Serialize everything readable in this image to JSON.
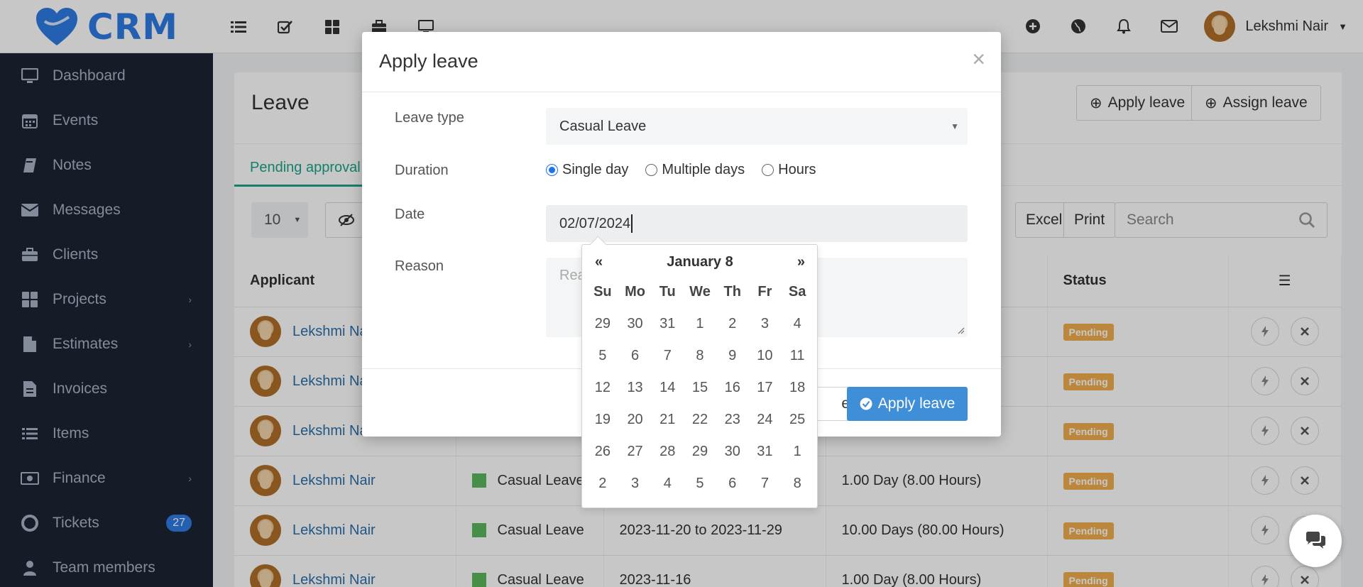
{
  "brand": {
    "name": "CRM",
    "logo_color": "#2d7be5"
  },
  "topbar": {
    "left_icons": [
      "list-icon",
      "check-square-icon",
      "grid-icon",
      "briefcase-icon",
      "monitor-icon"
    ],
    "right_icons": [
      "plus-circle-icon",
      "globe-icon",
      "bell-icon",
      "mail-icon"
    ],
    "user_name": "Lekshmi Nair"
  },
  "sidebar": {
    "items": [
      {
        "label": "Dashboard",
        "icon": "monitor-icon"
      },
      {
        "label": "Events",
        "icon": "calendar-icon"
      },
      {
        "label": "Notes",
        "icon": "book-icon"
      },
      {
        "label": "Messages",
        "icon": "envelope-icon"
      },
      {
        "label": "Clients",
        "icon": "briefcase-icon"
      },
      {
        "label": "Projects",
        "icon": "grid-icon",
        "has_submenu": true
      },
      {
        "label": "Estimates",
        "icon": "file-icon",
        "has_submenu": true
      },
      {
        "label": "Invoices",
        "icon": "file-text-icon"
      },
      {
        "label": "Items",
        "icon": "list-icon"
      },
      {
        "label": "Finance",
        "icon": "money-icon",
        "has_submenu": true
      },
      {
        "label": "Tickets",
        "icon": "lifebuoy-icon",
        "badge": "27"
      },
      {
        "label": "Team members",
        "icon": "user-icon"
      }
    ]
  },
  "page": {
    "title": "Leave",
    "apply_leave_label": "Apply leave",
    "assign_leave_label": "Assign leave",
    "active_tab": "Pending approval",
    "page_size": "10",
    "excel_label": "Excel",
    "print_label": "Print",
    "search_placeholder": "Search",
    "table": {
      "headers": [
        "Applicant",
        "",
        "",
        "",
        "Status",
        ""
      ],
      "rows": [
        {
          "applicant": "Lekshmi Nair",
          "type": "",
          "date": "",
          "duration": "",
          "status": "Pending"
        },
        {
          "applicant": "Lekshmi Nair",
          "type": "",
          "date": "",
          "duration": "",
          "status": "Pending"
        },
        {
          "applicant": "Lekshmi Nair",
          "type": "",
          "date": "",
          "duration": "",
          "status": "Pending"
        },
        {
          "applicant": "Lekshmi Nair",
          "type": "Casual Leave",
          "date": "",
          "duration": "1.00 Day (8.00 Hours)",
          "status": "Pending"
        },
        {
          "applicant": "Lekshmi Nair",
          "type": "Casual Leave",
          "date": "2023-11-20 to 2023-11-29",
          "duration": "10.00 Days (80.00 Hours)",
          "status": "Pending"
        },
        {
          "applicant": "Lekshmi Nair",
          "type": "Casual Leave",
          "date": "2023-11-16",
          "duration": "1.00 Day (8.00 Hours)",
          "status": "Pending"
        }
      ]
    }
  },
  "modal": {
    "title": "Apply leave",
    "close_symbol": "×",
    "leave_type_label": "Leave type",
    "leave_type_value": "Casual Leave",
    "duration_label": "Duration",
    "duration_options": [
      "Single day",
      "Multiple days",
      "Hours"
    ],
    "duration_selected": "Single day",
    "date_label": "Date",
    "date_value": "02/07/2024",
    "reason_label": "Reason",
    "reason_placeholder": "Rea",
    "close_button": "e",
    "apply_button": "Apply leave"
  },
  "datepicker": {
    "prev": "«",
    "title": "January 8",
    "next": "»",
    "weekdays": [
      "Su",
      "Mo",
      "Tu",
      "We",
      "Th",
      "Fr",
      "Sa"
    ],
    "weeks": [
      [
        "29",
        "30",
        "31",
        "1",
        "2",
        "3",
        "4"
      ],
      [
        "5",
        "6",
        "7",
        "8",
        "9",
        "10",
        "11"
      ],
      [
        "12",
        "13",
        "14",
        "15",
        "16",
        "17",
        "18"
      ],
      [
        "19",
        "20",
        "21",
        "22",
        "23",
        "24",
        "25"
      ],
      [
        "26",
        "27",
        "28",
        "29",
        "30",
        "31",
        "1"
      ],
      [
        "2",
        "3",
        "4",
        "5",
        "6",
        "7",
        "8"
      ]
    ]
  },
  "colors": {
    "sidebar_bg": "#1c2433",
    "accent": "#2d7be5",
    "tab_active": "#18a589",
    "pending": "#f0ad4e",
    "apply_btn": "#3f8fd8"
  }
}
